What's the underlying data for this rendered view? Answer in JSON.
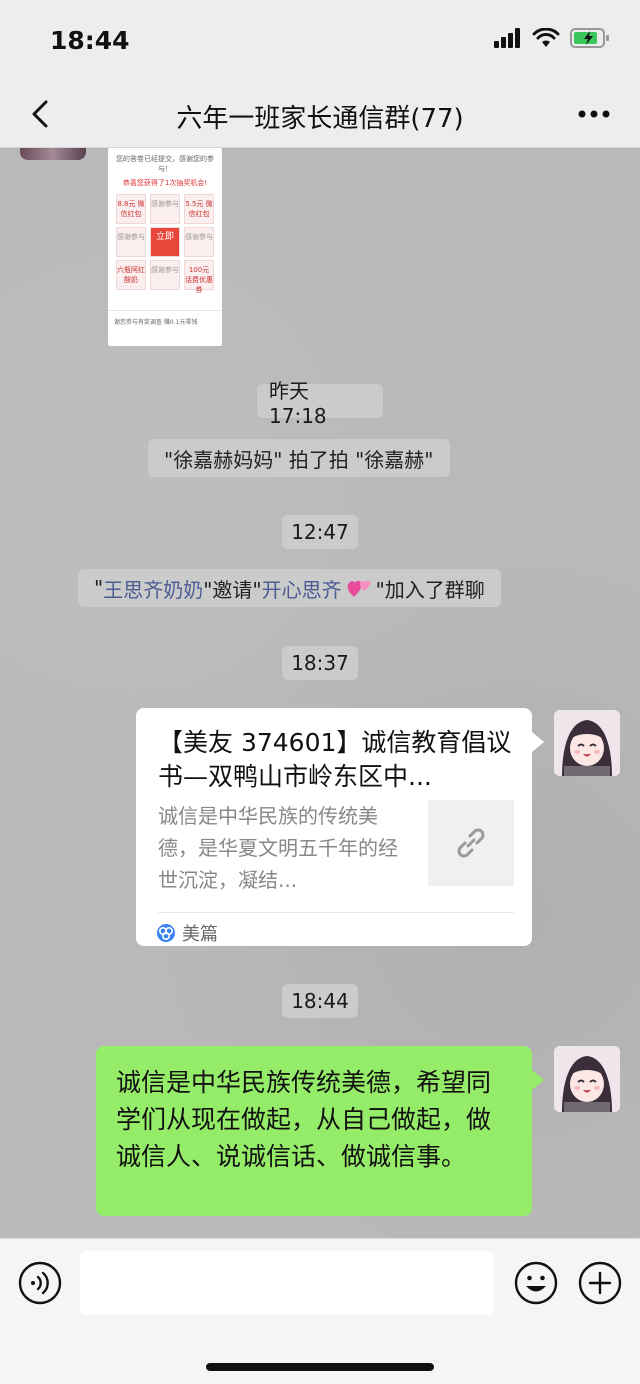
{
  "status": {
    "time": "18:44"
  },
  "nav": {
    "title": "六年一班家长通信群(77)"
  },
  "screenshot_thumb": {
    "line1": "您的答卷已经提交，感谢您的参与！",
    "line2": "恭喜您获得了1次抽奖机会!",
    "cells": [
      "8.8元 微信红包",
      "感谢参与",
      "5.5元 微信红包",
      "感谢参与",
      "立即",
      "感谢参与",
      "六瓶阿红酸奶",
      "感谢参与",
      "100元 话费优惠券"
    ],
    "bottom": "谢您参与有奖调查 赚0.1元零钱"
  },
  "chat": {
    "time1": "昨天 17:18",
    "pat": "\"徐嘉赫妈妈\" 拍了拍 \"徐嘉赫\"",
    "time2": "12:47",
    "invite": {
      "q1": "\"",
      "inviter": "王思齐奶奶",
      "mid": "\"邀请\"",
      "invitee": "开心思齐",
      "end": "\"加入了群聊"
    },
    "time3": "18:37",
    "link_card": {
      "title": "【美友 374601】诚信教育倡议书—双鸭山市岭东区中...",
      "description": "诚信是中华民族的传统美德，是华夏文明五千年的经世沉淀，凝结...",
      "source": "美篇"
    },
    "time4": "18:44",
    "message": "诚信是中华民族传统美德，希望同学们从现在做起，从自己做起，做诚信人、说诚信话、做诚信事。"
  },
  "input": {
    "value": ""
  }
}
